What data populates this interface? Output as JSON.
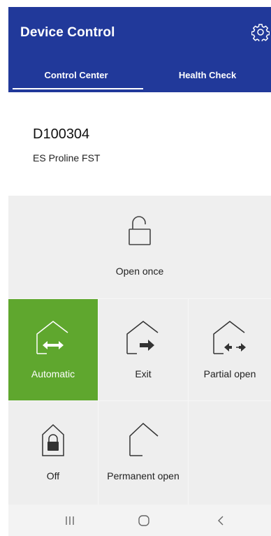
{
  "app_bar": {
    "title": "Device Control",
    "settings_icon": "gear-icon"
  },
  "tabs": [
    {
      "label": "Control Center",
      "active": true
    },
    {
      "label": "Health Check",
      "active": false
    }
  ],
  "device": {
    "id": "D100304",
    "model": "ES Proline FST"
  },
  "modes": {
    "open_once": {
      "label": "Open once",
      "icon": "unlock-icon"
    },
    "automatic": {
      "label": "Automatic",
      "icon": "house-two-way-arrow-icon",
      "active": true
    },
    "exit": {
      "label": "Exit",
      "icon": "house-exit-arrow-icon"
    },
    "partial_open": {
      "label": "Partial open",
      "icon": "house-partial-arrow-icon"
    },
    "off": {
      "label": "Off",
      "icon": "house-lock-icon"
    },
    "permanent_open": {
      "label": "Permanent open",
      "icon": "house-open-icon"
    }
  },
  "colors": {
    "app_bar": "#21399a",
    "active_mode": "#5fa72e",
    "tile_background": "#eeeeee"
  },
  "nav_bar": {
    "recent_icon": "recent-apps-icon",
    "home_icon": "home-icon",
    "back_icon": "back-icon"
  }
}
